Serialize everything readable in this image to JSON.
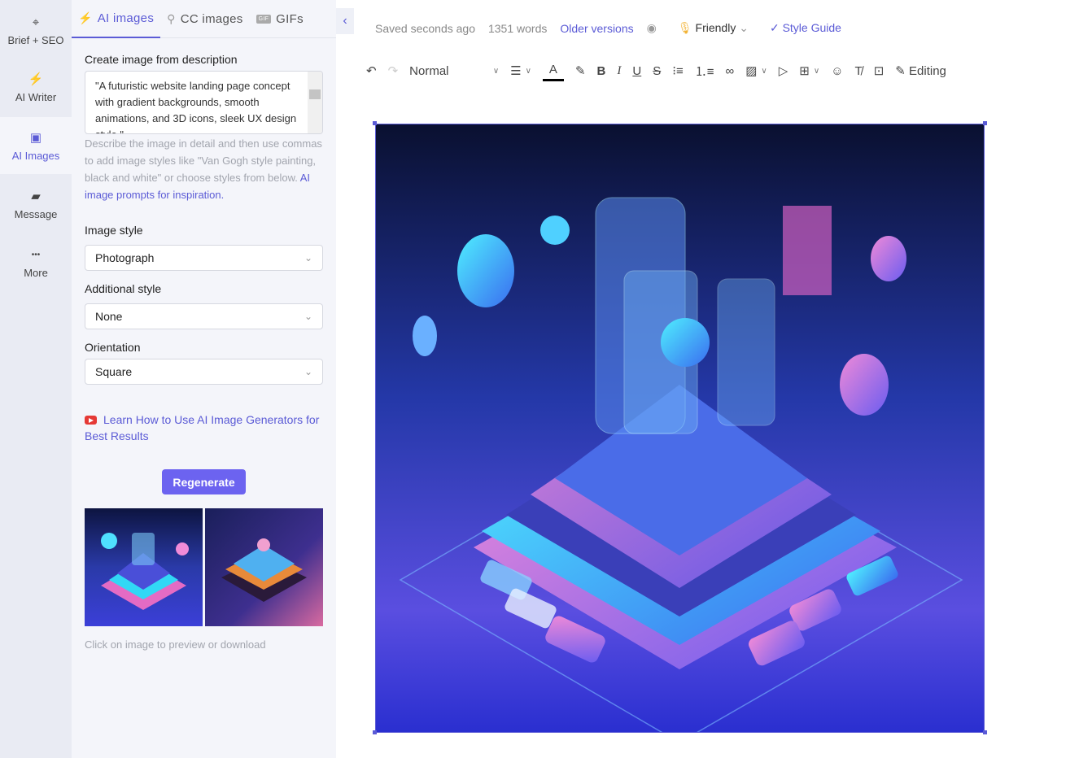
{
  "rail": [
    {
      "label": "Brief + SEO",
      "icon": "crosshair-icon",
      "glyph": "⌖"
    },
    {
      "label": "AI Writer",
      "icon": "lightning-icon",
      "glyph": "⚡"
    },
    {
      "label": "AI Images",
      "icon": "image-icon",
      "glyph": "▣"
    },
    {
      "label": "Message",
      "icon": "message-icon",
      "glyph": "▰"
    },
    {
      "label": "More",
      "icon": "more-icon",
      "glyph": "•••"
    }
  ],
  "tabs": [
    {
      "label": "AI images",
      "glyph": "⚡"
    },
    {
      "label": "CC images",
      "glyph": "⚲"
    },
    {
      "label": "GIFs",
      "glyph": "GIF"
    }
  ],
  "form": {
    "desc_label": "Create image from description",
    "desc_value": "\"A futuristic website landing page concept with gradient backgrounds, smooth animations, and 3D icons, sleek UX design style.\"",
    "help_text": "Describe the image in detail and then use commas to add image styles like \"Van Gogh style painting, black and white\" or choose styles from below. ",
    "help_link": "AI image prompts for inspiration.",
    "style_label": "Image style",
    "style_value": "Photograph",
    "add_label": "Additional style",
    "add_value": "None",
    "orient_label": "Orientation",
    "orient_value": "Square",
    "learn_link": "Learn How to Use AI Image Generators for Best Results",
    "regenerate": "Regenerate",
    "hint": "Click on image to preview or download"
  },
  "topbar": {
    "saved": "Saved seconds ago",
    "words": "1351 words",
    "older": "Older versions",
    "tone": "Friendly",
    "style_guide": "Style Guide"
  },
  "toolbar": {
    "format": "Normal",
    "mode": "Editing"
  },
  "colors": {
    "accent": "#5b5bd6",
    "button": "#6c63f0",
    "rail": "#e9ebf3",
    "panel": "#f4f5fa"
  }
}
